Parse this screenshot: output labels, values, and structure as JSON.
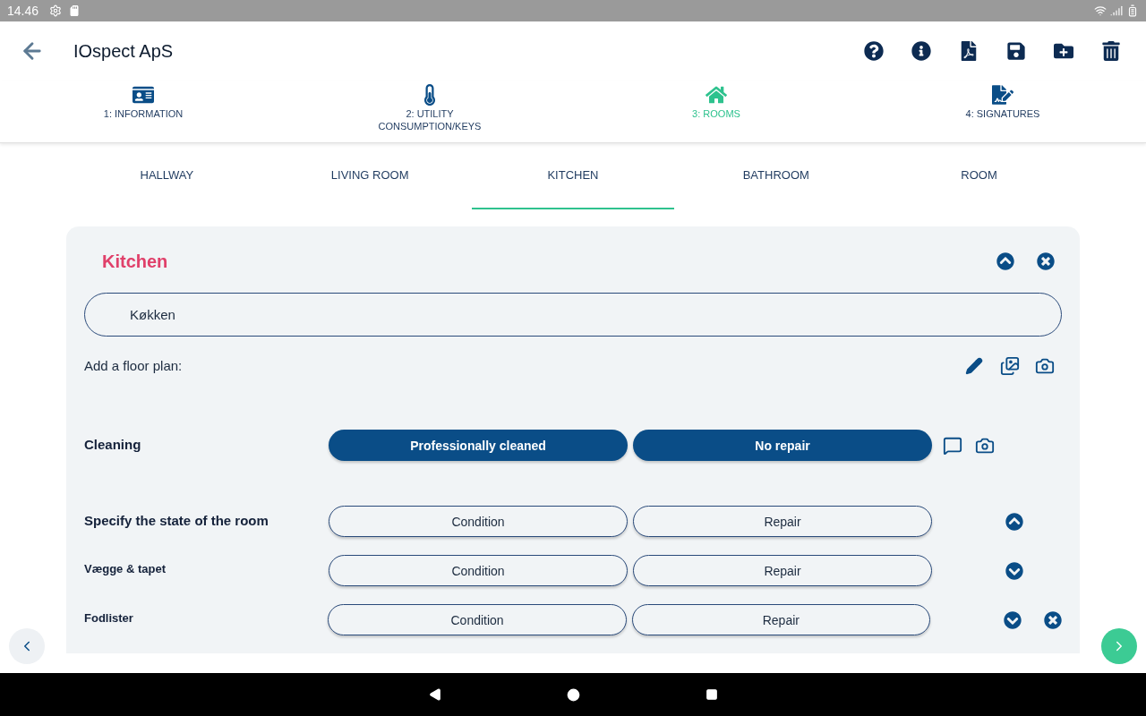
{
  "status_bar": {
    "time": "14.46"
  },
  "app_bar": {
    "title": "IOspect ApS"
  },
  "steps": [
    {
      "label": "1: INFORMATION",
      "selected": false
    },
    {
      "label": "2: UTILITY\nCONSUMPTION/KEYS",
      "selected": false
    },
    {
      "label": "3: ROOMS",
      "selected": true
    },
    {
      "label": "4: SIGNATURES",
      "selected": false
    }
  ],
  "room_tabs": [
    {
      "label": "HALLWAY",
      "selected": false
    },
    {
      "label": "LIVING ROOM",
      "selected": false
    },
    {
      "label": "KITCHEN",
      "selected": true
    },
    {
      "label": "BATHROOM",
      "selected": false
    },
    {
      "label": "ROOM",
      "selected": false
    }
  ],
  "room": {
    "title": "Kitchen",
    "name_field": {
      "value": "Køkken"
    },
    "floor_plan_label": "Add a floor plan:",
    "rows": [
      {
        "kind": "cleaning",
        "label": "Cleaning",
        "condition": {
          "label": "Professionally cleaned",
          "selected": true
        },
        "repair": {
          "label": "No repair",
          "selected": true
        }
      },
      {
        "kind": "header",
        "label": "Specify the state of the room",
        "condition": {
          "label": "Condition",
          "selected": false
        },
        "repair": {
          "label": "Repair",
          "selected": false
        },
        "expanded": true,
        "removable": false
      },
      {
        "kind": "item",
        "label": "Vægge & tapet",
        "condition": {
          "label": "Condition",
          "selected": false
        },
        "repair": {
          "label": "Repair",
          "selected": false
        },
        "expanded": false,
        "removable": false
      },
      {
        "kind": "item",
        "label": "Fodlister",
        "condition": {
          "label": "Condition",
          "selected": false
        },
        "repair": {
          "label": "Repair",
          "selected": false
        },
        "expanded": false,
        "removable": true
      }
    ]
  }
}
